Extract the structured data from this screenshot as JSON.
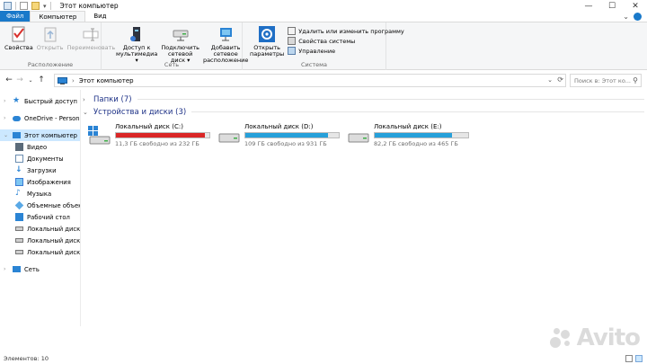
{
  "window": {
    "title": "Этот компьютер",
    "controls": {
      "minimize": "—",
      "maximize": "☐",
      "close": "✕"
    }
  },
  "ribbon_tabs": {
    "file": "Файл",
    "computer": "Компьютер",
    "view": "Вид"
  },
  "ribbon": {
    "location": {
      "label": "Расположение",
      "properties": "Свойства",
      "open": "Открыть",
      "rename": "Переименовать"
    },
    "network": {
      "label": "Сеть",
      "media_access": [
        "Доступ к",
        "мультимедиа"
      ],
      "map_drive": [
        "Подключить",
        "сетевой диск"
      ],
      "add_location": [
        "Добавить сетевое",
        "расположение"
      ]
    },
    "system": {
      "label": "Система",
      "open_settings": [
        "Открыть",
        "параметры"
      ],
      "uninstall": "Удалить или изменить программу",
      "system_properties": "Свойства системы",
      "manage": "Управление"
    }
  },
  "address": {
    "path": "Этот компьютер",
    "search_placeholder": "Поиск в: Этот ко..."
  },
  "nav": {
    "quick_access": "Быстрый доступ",
    "onedrive": "OneDrive - Personal",
    "this_pc": "Этот компьютер",
    "items": [
      "Видео",
      "Документы",
      "Загрузки",
      "Изображения",
      "Музыка",
      "Объемные объекты",
      "Рабочий стол",
      "Локальный диск (C:)",
      "Локальный диск (D:)",
      "Локальный диск (E:)"
    ],
    "network": "Сеть"
  },
  "content": {
    "folders_header": "Папки (7)",
    "devices_header": "Устройства и диски (3)",
    "drives": [
      {
        "name": "Локальный диск (C:)",
        "free_text": "11,3 ГБ свободно из 232 ГБ",
        "used_fraction": 0.951,
        "bar_color": "#da2626"
      },
      {
        "name": "Локальный диск (D:)",
        "free_text": "109 ГБ свободно из 931 ГБ",
        "used_fraction": 0.883,
        "bar_color": "#26a0da"
      },
      {
        "name": "Локальный диск (E:)",
        "free_text": "82,2 ГБ свободно из 465 ГБ",
        "used_fraction": 0.823,
        "bar_color": "#26a0da"
      }
    ]
  },
  "status": {
    "items_count": "Элементов: 10"
  },
  "watermark": {
    "text": "Avito"
  }
}
